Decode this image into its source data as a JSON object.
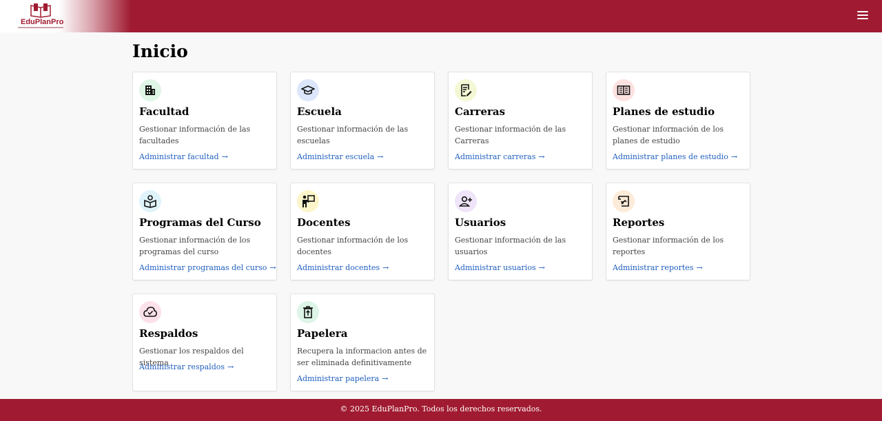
{
  "header": {
    "brand": "EduPlanPro",
    "menu_icon": "hamburger-icon",
    "accent": "#a01b31"
  },
  "page": {
    "title": "Inicio"
  },
  "cards": [
    {
      "icon": "building-icon",
      "icon_bg": "#dff5e6",
      "title": "Facultad",
      "desc": "Gestionar información de las facultades",
      "link": "Administrar facultad"
    },
    {
      "icon": "graduation-cap-icon",
      "icon_bg": "#dbe6fb",
      "title": "Escuela",
      "desc": "Gestionar información de las escuelas",
      "link": "Administrar escuela"
    },
    {
      "icon": "document-edit-icon",
      "icon_bg": "#f3f7d4",
      "title": "Carreras",
      "desc": "Gestionar información de las Carreras",
      "link": "Administrar carreras"
    },
    {
      "icon": "open-book-icon",
      "icon_bg": "#fde1e1",
      "title": "Planes de estudio",
      "desc": "Gestionar información de los planes de estudio",
      "link": "Administrar planes de estudio"
    },
    {
      "icon": "book-person-icon",
      "icon_bg": "#dff3fb",
      "title": "Programas del Curso",
      "desc": "Gestionar información de los programas del curso",
      "link": "Administrar programas del curso"
    },
    {
      "icon": "teacher-icon",
      "icon_bg": "#fdf5c9",
      "title": "Docentes",
      "desc": "Gestionar información de los docentes",
      "link": "Administrar docentes"
    },
    {
      "icon": "user-plus-icon",
      "icon_bg": "#efe4f9",
      "title": "Usuarios",
      "desc": "Gestionar información de las usuarios",
      "link": "Administrar usuarios"
    },
    {
      "icon": "report-icon",
      "icon_bg": "#fdebd9",
      "title": "Reportes",
      "desc": "Gestionar información de los reportes",
      "link": "Administrar reportes"
    },
    {
      "icon": "cloud-check-icon",
      "icon_bg": "#fbe1ea",
      "title": "Respaldos",
      "desc": "Gestionar los respaldos del sistema",
      "link": "Administrar respaldos"
    },
    {
      "icon": "trash-restore-icon",
      "icon_bg": "#dcf5e6",
      "title": "Papelera",
      "desc": "Recupera la informacion antes de ser eliminada definitivamente",
      "link": "Administrar papelera"
    }
  ],
  "footer": {
    "text": "© 2025 EduPlanPro. Todos los derechos reservados."
  }
}
